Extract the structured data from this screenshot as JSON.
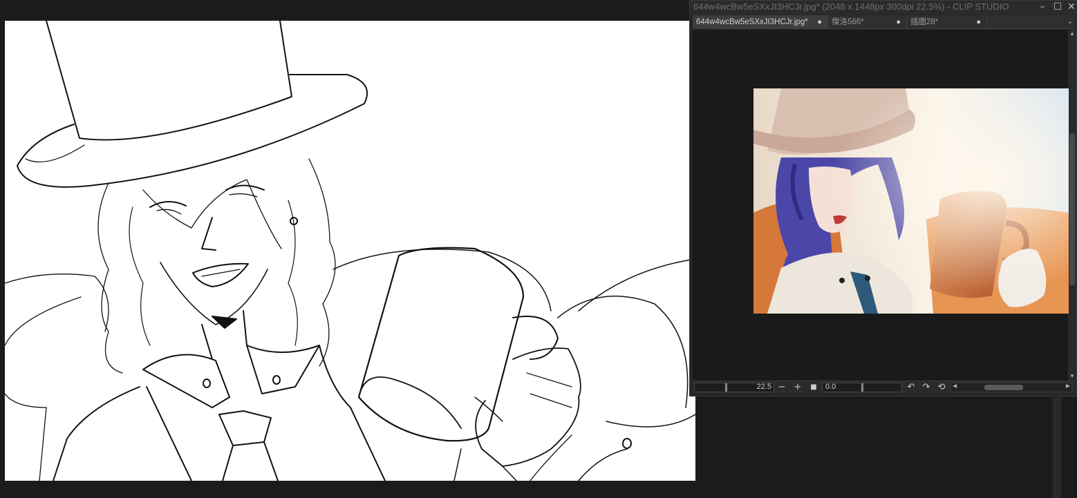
{
  "window": {
    "title": "644w4wcBw5eSXxJI3HCJr.jpg* (2048 x 1448px 300dpi 22.5%)  - CLIP STUDIO"
  },
  "tabs": [
    {
      "label": "644w4wcBw5eSXxJI3HCJr.jpg*",
      "active": true
    },
    {
      "label": "傑洛566*",
      "active": false
    },
    {
      "label": "插圖28*",
      "active": false
    }
  ],
  "navigator": {
    "zoom": "22.5",
    "rotation": "0.0"
  },
  "icons": {
    "minimize": "minimize-icon",
    "maximize": "maximize-icon",
    "close": "close-icon",
    "zoom_out": "minus-icon",
    "zoom_in": "plus-icon",
    "fit": "square-icon",
    "rotate_left": "rotate-left-icon",
    "rotate_right": "rotate-right-icon",
    "reset_rotation": "reset-rotation-icon"
  },
  "colors": {
    "background": "#1b1b1b",
    "panel": "#262626",
    "canvas": "#ffffff"
  }
}
